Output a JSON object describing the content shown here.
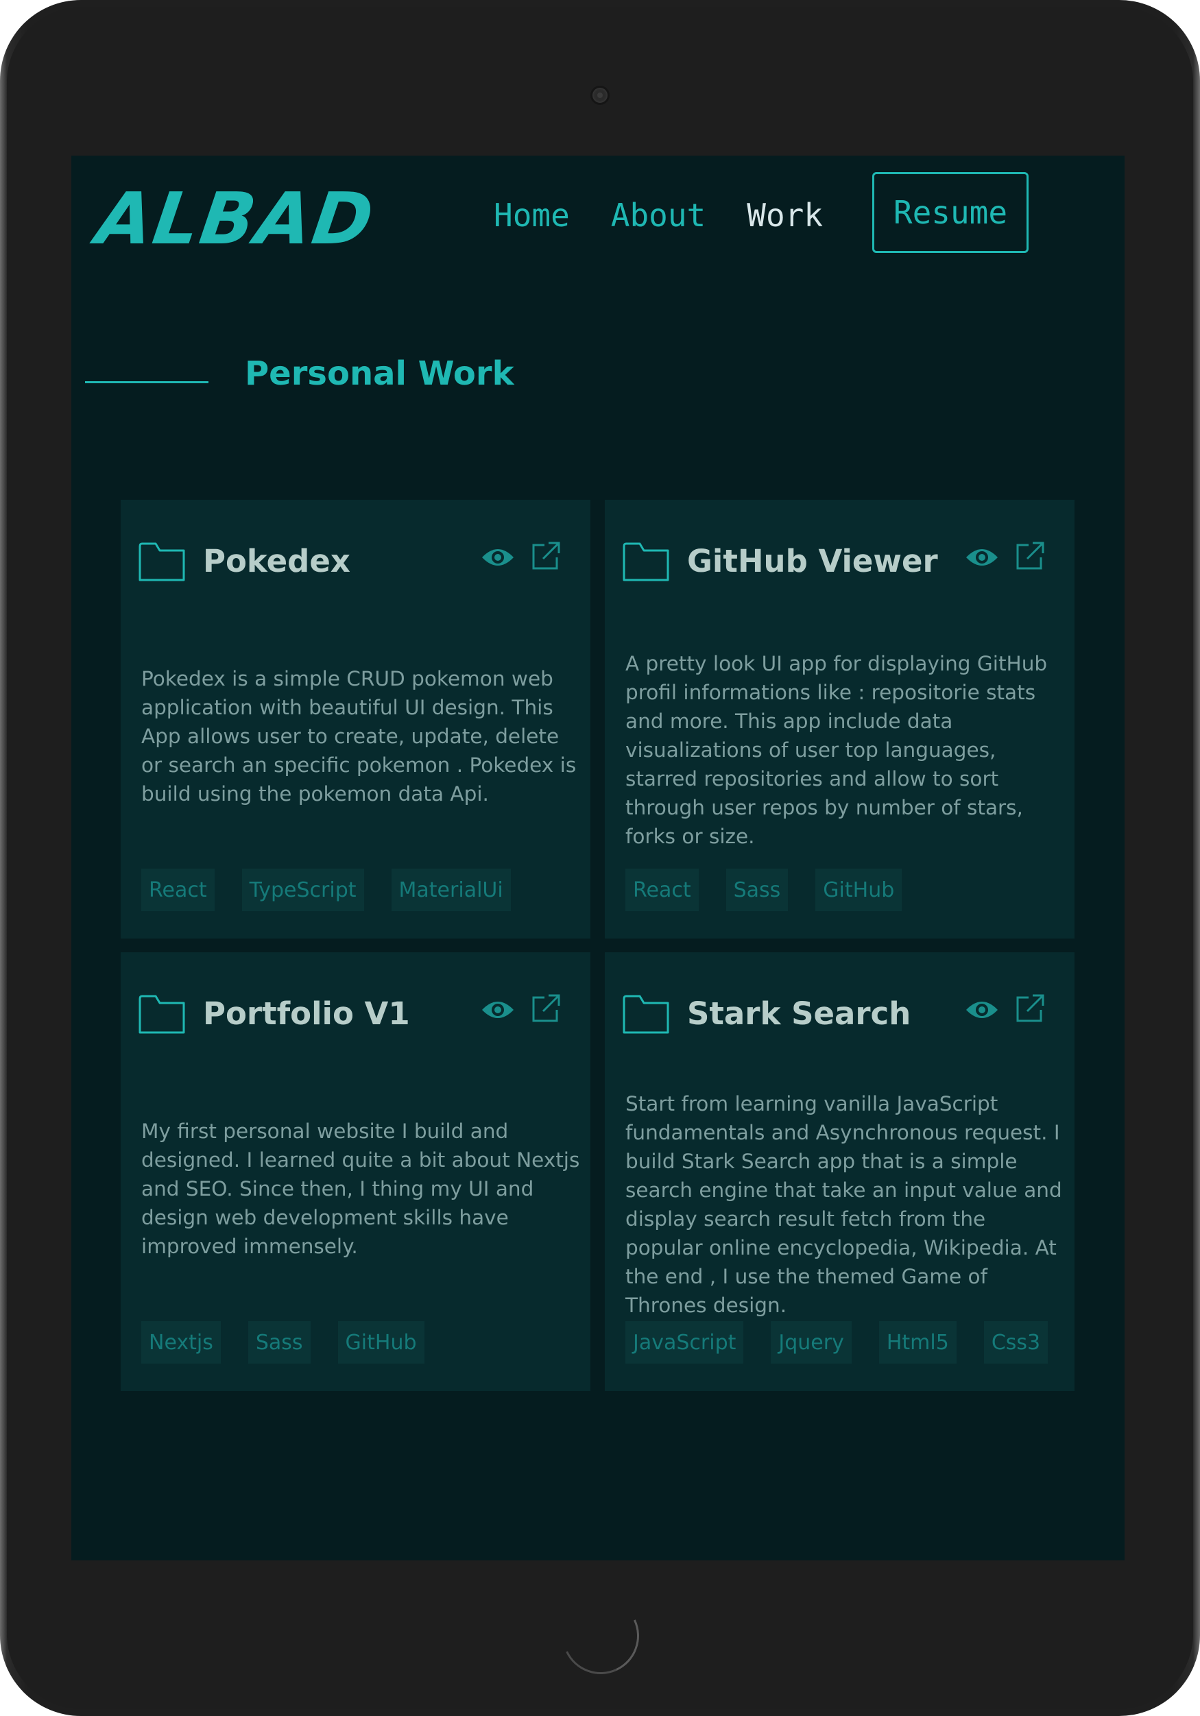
{
  "header": {
    "logo": "ALBAD",
    "nav": [
      "Home",
      "About",
      "Work"
    ],
    "active_nav": "Work",
    "resume_label": "Resume"
  },
  "section": {
    "title": "Personal Work"
  },
  "colors": {
    "accent": "#1fb8b3",
    "background": "#051c1f",
    "card": "#072a2d",
    "tag_bg": "#0a3436",
    "tag_text": "#157a79"
  },
  "icons": {
    "folder": "folder-icon",
    "view": "eye-icon",
    "external": "external-link-icon"
  },
  "projects": [
    {
      "title": "Pokedex",
      "description": "Pokedex is a simple CRUD pokemon web application with beautiful UI design. This App allows user to create, update, delete or search an specific pokemon . Pokedex is build using the pokemon data Api.",
      "tags": [
        "React",
        "TypeScript",
        "MaterialUi"
      ]
    },
    {
      "title": "GitHub Viewer",
      "description": "A pretty look UI app for displaying GitHub profil informations like : repositorie stats and more. This app include data visualizations of user top languages, starred repositories and allow to sort through user repos by number of stars, forks or size.",
      "tags": [
        "React",
        "Sass",
        "GitHub"
      ]
    },
    {
      "title": "Portfolio V1",
      "description": "My first personal website I build and designed. I learned quite a bit about Nextjs and SEO. Since then, I thing my UI and design web development skills have improved immensely.",
      "tags": [
        "Nextjs",
        "Sass",
        "GitHub"
      ]
    },
    {
      "title": "Stark Search",
      "description": "Start from learning vanilla JavaScript fundamentals and Asynchronous request. I build Stark Search app that is a simple search engine that take an input value and display search result fetch from the popular online encyclopedia, Wikipedia. At the end , I use the themed Game of Thrones design.",
      "tags": [
        "JavaScript",
        "Jquery",
        "Html5",
        "Css3"
      ]
    }
  ]
}
